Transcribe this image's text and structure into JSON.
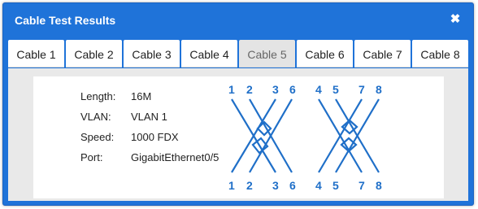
{
  "dialog": {
    "title": "Cable Test Results",
    "close_glyph": "✖"
  },
  "tabs": [
    {
      "label": "Cable 1",
      "active": false
    },
    {
      "label": "Cable 2",
      "active": false
    },
    {
      "label": "Cable 3",
      "active": false
    },
    {
      "label": "Cable 4",
      "active": false
    },
    {
      "label": "Cable 5",
      "active": true
    },
    {
      "label": "Cable 6",
      "active": false
    },
    {
      "label": "Cable 7",
      "active": false
    },
    {
      "label": "Cable 8",
      "active": false
    }
  ],
  "details": {
    "length_label": "Length:",
    "length_value": "16M",
    "vlan_label": "VLAN:",
    "vlan_value": "VLAN 1",
    "speed_label": "Speed:",
    "speed_value": "1000 FDX",
    "port_label": "Port:",
    "port_value": "GigabitEthernet0/5"
  },
  "pinout": {
    "top": [
      "1",
      "2",
      "3",
      "6",
      "4",
      "5",
      "7",
      "8"
    ],
    "bottom": [
      "1",
      "2",
      "3",
      "6",
      "4",
      "5",
      "7",
      "8"
    ],
    "color": "#1f6fc8"
  },
  "colors": {
    "titlebar": "#1f73d9",
    "active_tab": "#e4e4e4",
    "content_bg": "#e9e9e9"
  }
}
